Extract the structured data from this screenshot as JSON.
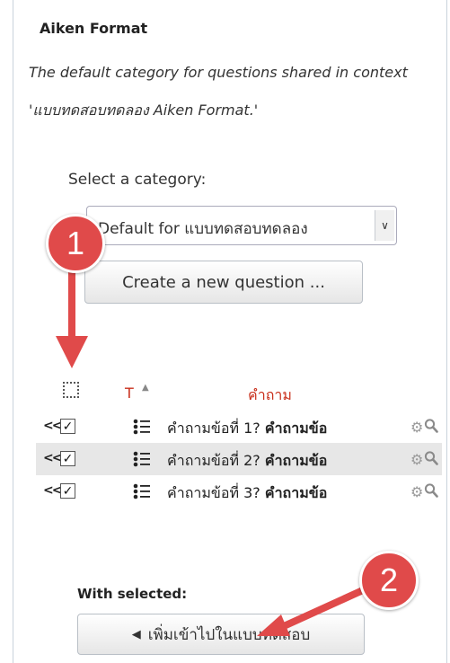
{
  "header": {
    "title": "Aiken Format",
    "description": "The default category for questions shared in context 'แบบทดสอบทดลอง Aiken Format.'"
  },
  "category": {
    "label": "Select a category:",
    "selected": "Default for แบบทดสอบทดลอง"
  },
  "create_button_label": "Create a new question ...",
  "table": {
    "col_type": "T",
    "col_question": "คำถาม",
    "rows": [
      {
        "name": "คำถามข้อที่ 1?",
        "text": "คำถามข้อ",
        "checked": true
      },
      {
        "name": "คำถามข้อที่ 2?",
        "text": "คำถามข้อ",
        "checked": true
      },
      {
        "name": "คำถามข้อที่ 3?",
        "text": "คำถามข้อ",
        "checked": true
      }
    ]
  },
  "with_selected_label": "With selected:",
  "add_button_label": "เพิ่มเข้าไปในแบบทดสอบ",
  "callouts": {
    "first": "1",
    "second": "2"
  },
  "icons": {
    "move": "move-arrows-icon",
    "type": "multichoice-icon",
    "edit": "gear-icon",
    "preview": "magnifier-icon",
    "sort": "sort-asc-icon",
    "dropdown": "chevron-down-icon"
  },
  "colors": {
    "accent_red": "#c9301c",
    "callout_red": "#e04a4a",
    "row_alt": "#e7e7e7"
  }
}
